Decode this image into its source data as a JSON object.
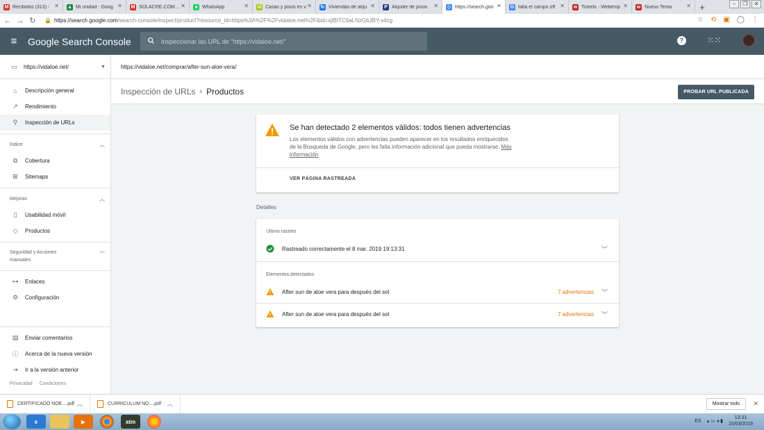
{
  "browser": {
    "tabs": [
      {
        "label": "Recibidos (313) -",
        "fav_color": "#d93025",
        "fav_glyph": "M",
        "active": false
      },
      {
        "label": "Mi unidad - Goog",
        "fav_color": "#1e8e3e",
        "fav_glyph": "▲",
        "active": false
      },
      {
        "label": "SOLACRE.COMPRA",
        "fav_color": "#d93025",
        "fav_glyph": "M",
        "active": false
      },
      {
        "label": "WhatsApp",
        "fav_color": "#25d366",
        "fav_glyph": "●",
        "active": false
      },
      {
        "label": "Casas y pisos en v",
        "fav_color": "#a4c400",
        "fav_glyph": "id",
        "active": false
      },
      {
        "label": "Viviendas de alqu",
        "fav_color": "#1a73e8",
        "fav_glyph": "fc",
        "active": false
      },
      {
        "label": "Alquiler de pisos",
        "fav_color": "#253b80",
        "fav_glyph": "P",
        "active": false
      },
      {
        "label": "https://search.goo",
        "fav_color": "#4285f4",
        "fav_glyph": "◎",
        "active": true
      },
      {
        "label": "falta el campo off",
        "fav_color": "#4285f4",
        "fav_glyph": "G",
        "active": false
      },
      {
        "label": "Tickets - Webemp",
        "fav_color": "#c5221f",
        "fav_glyph": "w",
        "active": false
      },
      {
        "label": "Nuevo Tema",
        "fav_color": "#c5221f",
        "fav_glyph": "w",
        "active": false
      }
    ],
    "new_tab": "+",
    "url_host": "https://search.google.com",
    "url_path": "/search-console/inspect/product?resource_id=https%3A%2F%2Fvidaloe.net%2F&id=xjiBITC6aLNzGbJBY-x4zg"
  },
  "header": {
    "brand": "Google Search Console",
    "search_placeholder": "Inspeccionar las URL de \"https://vidaloe.net/\""
  },
  "sidebar": {
    "property": "https://vidaloe.net/",
    "items_top": [
      {
        "label": "Descripción general",
        "icon": "home-icon"
      },
      {
        "label": "Rendimiento",
        "icon": "trending-icon"
      },
      {
        "label": "Inspección de URLs",
        "icon": "search-icon",
        "active": true
      }
    ],
    "section_index": "Índice",
    "items_index": [
      {
        "label": "Cobertura",
        "icon": "copy-icon"
      },
      {
        "label": "Sitemaps",
        "icon": "sitemap-icon"
      }
    ],
    "section_improve": "Mejoras",
    "items_improve": [
      {
        "label": "Usabilidad móvil",
        "icon": "phone-icon"
      },
      {
        "label": "Productos",
        "icon": "diamond-icon"
      }
    ],
    "section_security": "Seguridad y Acciones manuales",
    "items_links": [
      {
        "label": "Enlaces",
        "icon": "links-icon"
      },
      {
        "label": "Configuración",
        "icon": "gear-icon"
      }
    ],
    "items_bottom": [
      {
        "label": "Enviar comentarios",
        "icon": "feedback-icon"
      },
      {
        "label": "Acerca de la nueva versión",
        "icon": "info-icon"
      },
      {
        "label": "Ir a la versión anterior",
        "icon": "exit-icon"
      }
    ],
    "footer": [
      "Privacidad",
      "Condiciones"
    ]
  },
  "main": {
    "inspected_url": "https://vidaloe.net/comprar/after-sun-aloe-vera/",
    "breadcrumb_parent": "Inspección de URLs",
    "breadcrumb_current": "Productos",
    "test_button": "PROBAR URL PUBLICADA",
    "summary": {
      "title": "Se han detectado 2 elementos válidos: todos tienen advertencias",
      "description": "Los elementos válidos con advertencias pueden aparecer en los resultados enriquecidos de la Búsqueda de Google, pero les falta información adicional que pueda mostrarse.",
      "learn_more": "Más información",
      "view_crawled": "VER PÁGINA RASTREADA"
    },
    "details_label": "Detalles",
    "last_crawl_label": "Último rastreo",
    "last_crawl_text": "Rastreado correctamente el 8 mar. 2019 19:13:31",
    "detected_label": "Elementos detectados",
    "detected_items": [
      {
        "name": "After sun de aloe vera para después del sol",
        "warnings": "7 advertencias"
      },
      {
        "name": "After sun de aloe vera para después del sol",
        "warnings": "7 advertencias"
      }
    ]
  },
  "downloads": {
    "items": [
      "CERTIFICADO NOE....pdf",
      "CURRICULUM NO....pdf"
    ],
    "show_all": "Mostrar todo"
  },
  "taskbar": {
    "lang": "ES",
    "time": "13:31",
    "date": "15/03/2019"
  },
  "colors": {
    "header_bg": "#455a64",
    "warning": "#f29900",
    "warning_text": "#e37400",
    "success": "#1e8e3e"
  }
}
